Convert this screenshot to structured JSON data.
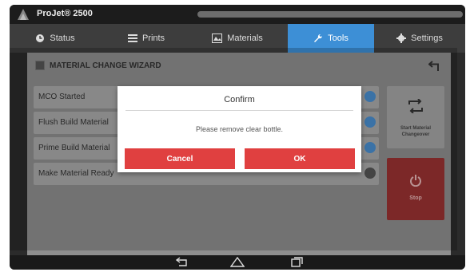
{
  "app": {
    "title": "ProJet® 2500"
  },
  "tabs": [
    {
      "label": "Status",
      "icon": "clock-icon"
    },
    {
      "label": "Prints",
      "icon": "list-icon"
    },
    {
      "label": "Materials",
      "icon": "materials-icon"
    },
    {
      "label": "Tools",
      "icon": "wrench-icon",
      "active": true
    },
    {
      "label": "Settings",
      "icon": "gear-icon"
    }
  ],
  "wizard": {
    "title": "MATERIAL CHANGE WIZARD",
    "steps": [
      {
        "label": "MCO Started",
        "done": true
      },
      {
        "label": "Flush Build Material",
        "done": true
      },
      {
        "label": "Prime Build Material",
        "done": true
      },
      {
        "label": "Make Material Ready",
        "done": false
      }
    ],
    "start_button": "Start Material Changeover",
    "stop_button": "Stop"
  },
  "dialog": {
    "title": "Confirm",
    "message": "Please remove clear bottle.",
    "cancel_label": "Cancel",
    "ok_label": "OK"
  },
  "colors": {
    "accent": "#3d8fd6",
    "danger": "#e04040",
    "stop": "#9c3333"
  }
}
